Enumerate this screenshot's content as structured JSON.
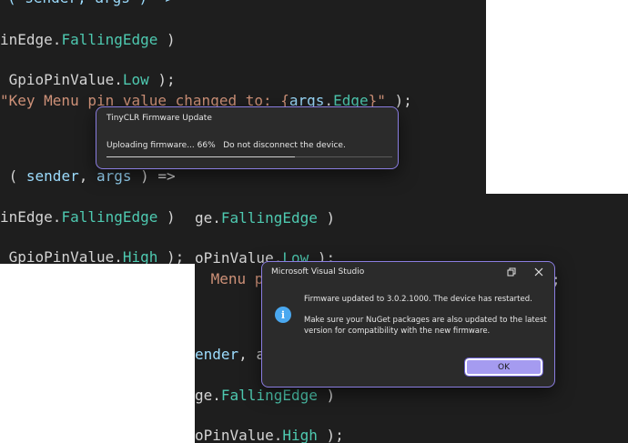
{
  "editor_top": {
    "lines": [
      {
        "segments": [
          {
            "text": "( sender, args ) =>",
            "color": "blue"
          }
        ]
      },
      {
        "segments": [
          {
            "text": "inEdge.",
            "color": "white"
          },
          {
            "text": "FallingEdge",
            "color": "teal"
          },
          {
            "text": " )",
            "color": "white"
          }
        ]
      },
      {
        "segments": [
          {
            "text": " GpioPinValue.",
            "color": "white"
          },
          {
            "text": "Low",
            "color": "teal"
          },
          {
            "text": " );",
            "color": "white"
          }
        ]
      },
      {
        "segments": [
          {
            "text": "\"Key Menu pin value changed to: {",
            "color": "str"
          },
          {
            "text": "args",
            "color": "blue"
          },
          {
            "text": ".",
            "color": "white"
          },
          {
            "text": "Edge",
            "color": "teal"
          },
          {
            "text": "}\"",
            "color": "str"
          },
          {
            "text": " );",
            "color": "white"
          }
        ]
      },
      {
        "segments": [
          {
            "text": " ( ",
            "color": "white"
          },
          {
            "text": "sender",
            "color": "blue"
          },
          {
            "text": ", ",
            "color": "white"
          },
          {
            "text": "args",
            "color": "blue"
          },
          {
            "text": " ) =>",
            "color": "white"
          }
        ]
      },
      {
        "segments": [
          {
            "text": "inEdge.",
            "color": "white"
          },
          {
            "text": "FallingEdge",
            "color": "teal"
          },
          {
            "text": " )",
            "color": "white"
          }
        ]
      },
      {
        "segments": [
          {
            "text": " GpioPinValue.",
            "color": "white"
          },
          {
            "text": "High",
            "color": "teal"
          },
          {
            "text": " );",
            "color": "white"
          }
        ]
      }
    ]
  },
  "editor_bottom": {
    "lines": [
      {
        "segments": [
          {
            "text": "ge.",
            "color": "white"
          },
          {
            "text": "FallingEdge",
            "color": "teal"
          },
          {
            "text": " )",
            "color": "white"
          }
        ]
      },
      {
        "segments": [
          {
            "text": "oPinValue.",
            "color": "white"
          },
          {
            "text": "Low",
            "color": "teal"
          },
          {
            "text": " );",
            "color": "white"
          }
        ]
      },
      {
        "segments": [
          {
            "text": " Menu pi",
            "color": "str"
          }
        ]
      },
      {
        "segments": [
          {
            "text": ";",
            "color": "white"
          }
        ]
      },
      {
        "segments": [
          {
            "text": "ender",
            "color": "blue"
          },
          {
            "text": ", a",
            "color": "white"
          }
        ]
      },
      {
        "segments": [
          {
            "text": "ge.",
            "color": "white"
          },
          {
            "text": "FallingEdge",
            "color": "teal"
          },
          {
            "text": " )",
            "color": "white"
          }
        ]
      },
      {
        "segments": [
          {
            "text": "oPinValue.",
            "color": "white"
          },
          {
            "text": "High",
            "color": "teal"
          },
          {
            "text": " );",
            "color": "white"
          }
        ]
      }
    ]
  },
  "progress_dialog": {
    "title": "TinyCLR Firmware Update",
    "status": "Uploading firmware... 66%   Do not disconnect the device.",
    "progress": 0.66
  },
  "message_dialog": {
    "title": "Microsoft Visual Studio",
    "icon": "info-icon",
    "line1": "Firmware updated to 3.0.2.1000. The device has restarted.",
    "line2": "Make sure your NuGet packages are also updated to the latest version for compatibility with the new firmware.",
    "ok_label": "OK"
  },
  "colors": {
    "accent": "#8a7de0",
    "ok_button": "#a59bf0",
    "info_icon": "#4aa8f0",
    "editor_bg": "#1e1e1e",
    "dialog_bg": "#2b2b2b"
  }
}
